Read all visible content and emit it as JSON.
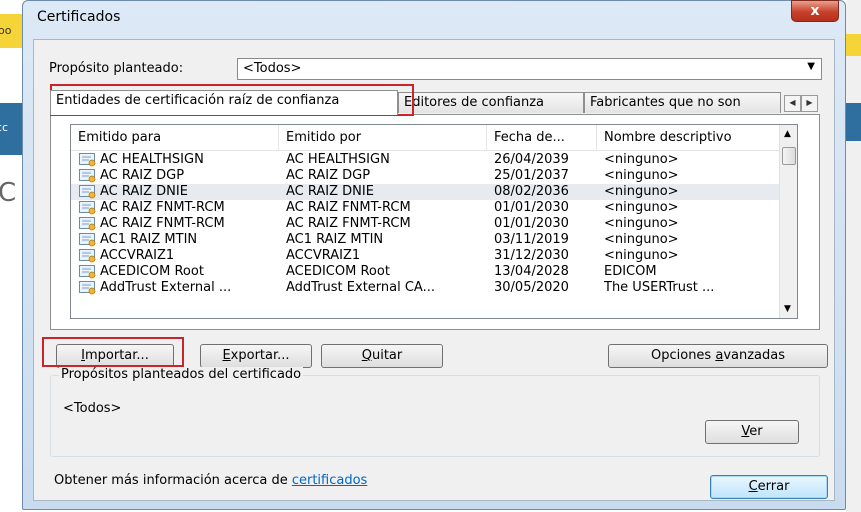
{
  "background": {
    "left_yellow_text": "oo",
    "left_blue_text": "cc",
    "left_letter": "C"
  },
  "window": {
    "title": "Certificados",
    "close_label": "x",
    "purpose_label": "Propósito planteado:",
    "purpose_value": "<Todos>"
  },
  "tabs": [
    {
      "label": "Entidades de certificación raíz de confianza",
      "active": true
    },
    {
      "label": "Editores de confianza",
      "active": false
    },
    {
      "label": "Fabricantes que no son",
      "active": false
    }
  ],
  "columns": [
    "Emitido para",
    "Emitido por",
    "Fecha de...",
    "Nombre descriptivo"
  ],
  "rows": [
    {
      "issued_to": "AC HEALTHSIGN",
      "issued_by": "AC HEALTHSIGN",
      "date": "26/04/2039",
      "name": "<ninguno>"
    },
    {
      "issued_to": "AC RAIZ DGP",
      "issued_by": "AC RAIZ DGP",
      "date": "25/01/2037",
      "name": "<ninguno>"
    },
    {
      "issued_to": "AC RAIZ DNIE",
      "issued_by": "AC RAIZ DNIE",
      "date": "08/02/2036",
      "name": "<ninguno>"
    },
    {
      "issued_to": "AC RAIZ FNMT-RCM",
      "issued_by": "AC RAIZ FNMT-RCM",
      "date": "01/01/2030",
      "name": "<ninguno>"
    },
    {
      "issued_to": "AC RAIZ FNMT-RCM",
      "issued_by": "AC RAIZ FNMT-RCM",
      "date": "01/01/2030",
      "name": "<ninguno>"
    },
    {
      "issued_to": "AC1 RAIZ MTIN",
      "issued_by": "AC1 RAIZ MTIN",
      "date": "03/11/2019",
      "name": "<ninguno>"
    },
    {
      "issued_to": "ACCVRAIZ1",
      "issued_by": "ACCVRAIZ1",
      "date": "31/12/2030",
      "name": "<ninguno>"
    },
    {
      "issued_to": "ACEDICOM Root",
      "issued_by": "ACEDICOM Root",
      "date": "13/04/2028",
      "name": "EDICOM"
    },
    {
      "issued_to": "AddTrust External ...",
      "issued_by": "AddTrust External CA...",
      "date": "30/05/2020",
      "name": "The USERTrust ..."
    }
  ],
  "selected_row": 2,
  "buttons": {
    "import_pre": "",
    "import_key": "I",
    "import_post": "mportar...",
    "export_pre": "",
    "export_key": "E",
    "export_post": "xportar...",
    "remove_pre": "",
    "remove_key": "Q",
    "remove_post": "uitar",
    "advanced_pre": "Opciones ",
    "advanced_key": "a",
    "advanced_post": "vanzadas",
    "view_pre": "",
    "view_key": "V",
    "view_post": "er",
    "close_pre": "",
    "close_key": "C",
    "close_post": "errar"
  },
  "group": {
    "title": "Propósitos planteados del certificado",
    "value": "<Todos>"
  },
  "info": {
    "text": "Obtener más información acerca de ",
    "link": "certificados"
  },
  "colors": {
    "highlight": "#c9252b",
    "link": "#0066cc"
  }
}
